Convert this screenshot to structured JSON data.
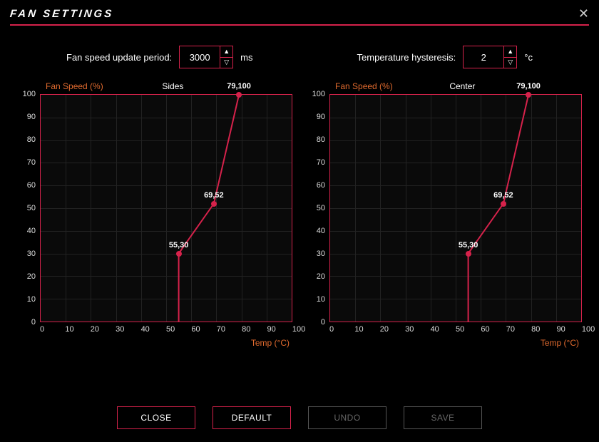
{
  "title": "FAN SETTINGS",
  "controls": {
    "update_period": {
      "label": "Fan speed update period:",
      "value": "3000",
      "unit": "ms"
    },
    "hysteresis": {
      "label": "Temperature hysteresis:",
      "value": "2",
      "unit": "°c"
    }
  },
  "chart_defs": {
    "y_label": "Fan Speed (%)",
    "x_label": "Temp (°C)",
    "xlim": [
      0,
      100
    ],
    "ylim": [
      0,
      100
    ],
    "y_ticks": [
      0,
      10,
      20,
      30,
      40,
      50,
      60,
      70,
      80,
      90,
      100
    ],
    "x_ticks": [
      0,
      10,
      20,
      30,
      40,
      50,
      60,
      70,
      80,
      90,
      100
    ]
  },
  "chart_data": [
    {
      "type": "line",
      "title": "Sides",
      "x": [
        55,
        69,
        79
      ],
      "y": [
        30,
        52,
        100
      ],
      "point_labels": [
        "55,30",
        "69,52",
        "79,100"
      ]
    },
    {
      "type": "line",
      "title": "Center",
      "x": [
        55,
        69,
        79
      ],
      "y": [
        30,
        52,
        100
      ],
      "point_labels": [
        "55,30",
        "69,52",
        "79,100"
      ]
    }
  ],
  "buttons": {
    "close": {
      "label": "CLOSE",
      "enabled": true
    },
    "default": {
      "label": "DEFAULT",
      "enabled": true
    },
    "undo": {
      "label": "UNDO",
      "enabled": false
    },
    "save": {
      "label": "SAVE",
      "enabled": false
    }
  }
}
